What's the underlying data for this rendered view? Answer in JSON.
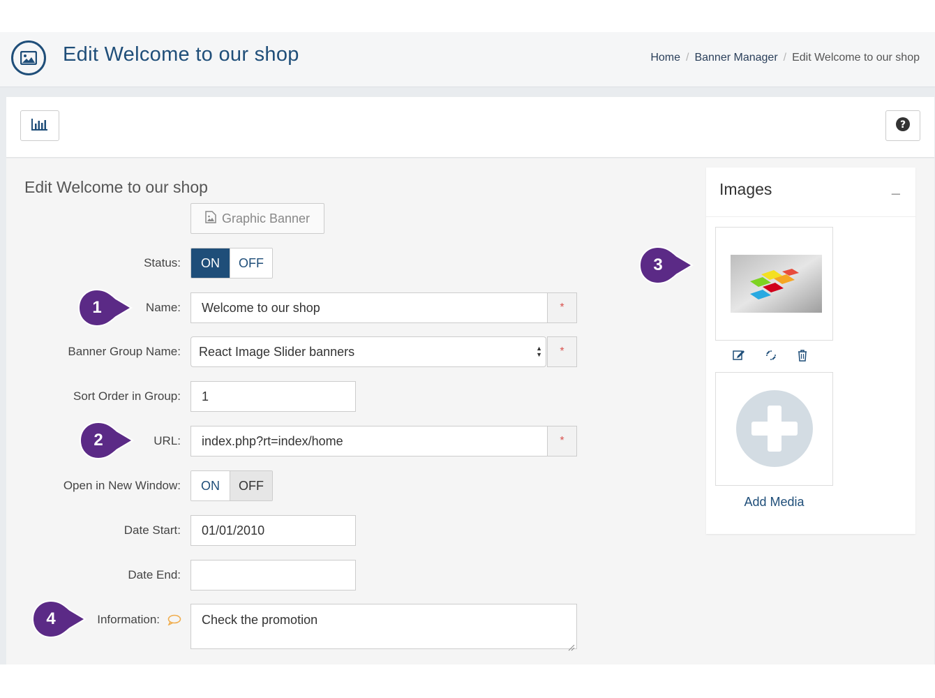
{
  "header": {
    "title": "Edit Welcome to our shop",
    "icon": "image-icon",
    "breadcrumb": {
      "home": "Home",
      "separator": "/",
      "banner_manager": "Banner Manager",
      "current": "Edit Welcome to our shop"
    }
  },
  "toolbar": {
    "stats_icon": "bar-chart-icon",
    "help_icon": "question-icon"
  },
  "form": {
    "title": "Edit Welcome to our shop",
    "banner_type": "Graphic Banner",
    "status": {
      "label": "Status:",
      "on": "ON",
      "off": "OFF",
      "value": "ON"
    },
    "name": {
      "label": "Name:",
      "value": "Welcome to our shop",
      "required": "*"
    },
    "banner_group": {
      "label": "Banner Group Name:",
      "value": "React Image Slider banners",
      "required": "*"
    },
    "sort_order": {
      "label": "Sort Order in Group:",
      "value": "1"
    },
    "url": {
      "label": "URL:",
      "value": "index.php?rt=index/home",
      "required": "*"
    },
    "new_window": {
      "label": "Open in New Window:",
      "on": "ON",
      "off": "OFF",
      "value": "OFF"
    },
    "date_start": {
      "label": "Date Start:",
      "value": "01/01/2010"
    },
    "date_end": {
      "label": "Date End:",
      "value": ""
    },
    "information": {
      "label": "Information:",
      "value": "Check the promotion"
    }
  },
  "images": {
    "title": "Images",
    "collapse": "–",
    "add_media": "Add Media"
  },
  "markers": [
    "1",
    "2",
    "3",
    "4"
  ],
  "colors": {
    "primary": "#1f4e79",
    "marker": "#5b2a86",
    "required": "#d9534f",
    "info_icon": "#f0ad4e"
  }
}
